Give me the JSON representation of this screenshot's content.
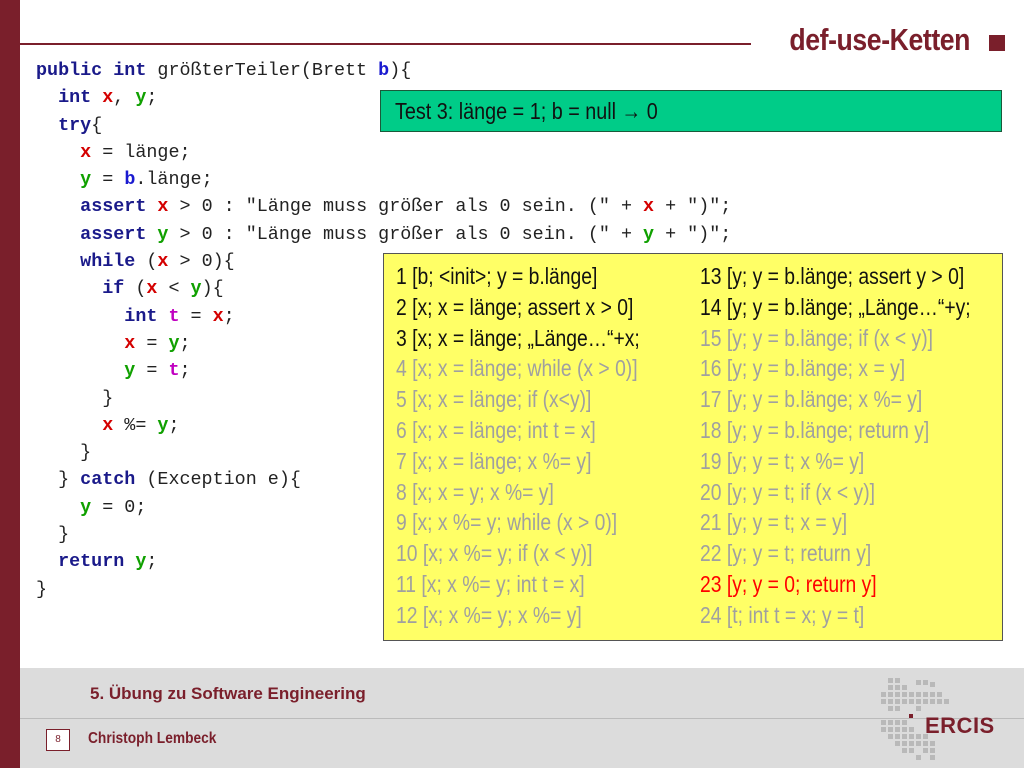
{
  "slide": {
    "title": "def-use-Ketten"
  },
  "code": [
    [
      {
        "t": "public",
        "c": "kw"
      },
      {
        "t": " "
      },
      {
        "t": "int",
        "c": "kw"
      },
      {
        "t": " größterTeiler(Brett "
      },
      {
        "t": "b",
        "c": "vb"
      },
      {
        "t": "){"
      }
    ],
    [
      {
        "t": "  "
      },
      {
        "t": "int",
        "c": "kw"
      },
      {
        "t": " "
      },
      {
        "t": "x",
        "c": "vx"
      },
      {
        "t": ", "
      },
      {
        "t": "y",
        "c": "vy"
      },
      {
        "t": ";"
      }
    ],
    [
      {
        "t": "  "
      },
      {
        "t": "try",
        "c": "kw"
      },
      {
        "t": "{"
      }
    ],
    [
      {
        "t": "    "
      },
      {
        "t": "x",
        "c": "vx"
      },
      {
        "t": " = länge;"
      }
    ],
    [
      {
        "t": "    "
      },
      {
        "t": "y",
        "c": "vy"
      },
      {
        "t": " = "
      },
      {
        "t": "b",
        "c": "vb"
      },
      {
        "t": ".länge;"
      }
    ],
    [
      {
        "t": "    "
      },
      {
        "t": "assert",
        "c": "kw"
      },
      {
        "t": " "
      },
      {
        "t": "x",
        "c": "vx"
      },
      {
        "t": " > 0 : \"Länge muss größer als 0 sein. (\" + "
      },
      {
        "t": "x",
        "c": "vx"
      },
      {
        "t": " + \")\";"
      }
    ],
    [
      {
        "t": "    "
      },
      {
        "t": "assert",
        "c": "kw"
      },
      {
        "t": " "
      },
      {
        "t": "y",
        "c": "vy"
      },
      {
        "t": " > 0 : \"Länge muss größer als 0 sein. (\" + "
      },
      {
        "t": "y",
        "c": "vy"
      },
      {
        "t": " + \")\";"
      }
    ],
    [
      {
        "t": "    "
      },
      {
        "t": "while",
        "c": "kw"
      },
      {
        "t": " ("
      },
      {
        "t": "x",
        "c": "vx"
      },
      {
        "t": " > 0){"
      }
    ],
    [
      {
        "t": "      "
      },
      {
        "t": "if",
        "c": "kw"
      },
      {
        "t": " ("
      },
      {
        "t": "x",
        "c": "vx"
      },
      {
        "t": " < "
      },
      {
        "t": "y",
        "c": "vy"
      },
      {
        "t": "){"
      }
    ],
    [
      {
        "t": "        "
      },
      {
        "t": "int",
        "c": "kw"
      },
      {
        "t": " "
      },
      {
        "t": "t",
        "c": "vt"
      },
      {
        "t": " = "
      },
      {
        "t": "x",
        "c": "vx"
      },
      {
        "t": ";"
      }
    ],
    [
      {
        "t": "        "
      },
      {
        "t": "x",
        "c": "vx"
      },
      {
        "t": " = "
      },
      {
        "t": "y",
        "c": "vy"
      },
      {
        "t": ";"
      }
    ],
    [
      {
        "t": "        "
      },
      {
        "t": "y",
        "c": "vy"
      },
      {
        "t": " = "
      },
      {
        "t": "t",
        "c": "vt"
      },
      {
        "t": ";"
      }
    ],
    [
      {
        "t": "      }"
      }
    ],
    [
      {
        "t": "      "
      },
      {
        "t": "x",
        "c": "vx"
      },
      {
        "t": " %= "
      },
      {
        "t": "y",
        "c": "vy"
      },
      {
        "t": ";"
      }
    ],
    [
      {
        "t": "    }"
      }
    ],
    [
      {
        "t": "  } "
      },
      {
        "t": "catch",
        "c": "kw"
      },
      {
        "t": " (Exception e){"
      }
    ],
    [
      {
        "t": "    "
      },
      {
        "t": "y",
        "c": "vy"
      },
      {
        "t": " = 0;"
      }
    ],
    [
      {
        "t": "  }"
      }
    ],
    [
      {
        "t": "  "
      },
      {
        "t": "return",
        "c": "kw"
      },
      {
        "t": " "
      },
      {
        "t": "y",
        "c": "vy"
      },
      {
        "t": ";"
      }
    ],
    [
      {
        "t": "}"
      }
    ]
  ],
  "test_case": {
    "prefix": "Test 3: länge = 1; b = null",
    "arrow": "→",
    "result": "0"
  },
  "chains_left": [
    {
      "text": "  1 [b; <init>; y = b.länge]",
      "status": "black"
    },
    {
      "text": "  2 [x; x = länge; assert x > 0]",
      "status": "black"
    },
    {
      "text": "  3 [x; x = länge; „Länge…“+x;",
      "status": "black"
    },
    {
      "text": "  4 [x; x = länge; while (x > 0)]",
      "status": "grey"
    },
    {
      "text": "  5 [x; x = länge; if (x<y)]",
      "status": "grey"
    },
    {
      "text": "  6 [x; x = länge; int t = x]",
      "status": "grey"
    },
    {
      "text": "  7 [x; x = länge; x %= y]",
      "status": "grey"
    },
    {
      "text": "  8 [x; x = y; x %= y]",
      "status": "grey"
    },
    {
      "text": "  9 [x; x %= y; while (x > 0)]",
      "status": "grey"
    },
    {
      "text": "10 [x; x %= y; if (x < y)]",
      "status": "grey"
    },
    {
      "text": "11 [x; x %= y; int t = x]",
      "status": "grey"
    },
    {
      "text": "12 [x; x %= y; x %= y]",
      "status": "grey"
    }
  ],
  "chains_right": [
    {
      "text": "13 [y; y = b.länge; assert y > 0]",
      "status": "black"
    },
    {
      "text": "14 [y; y = b.länge; „Länge…“+y;",
      "status": "black"
    },
    {
      "text": "15 [y; y = b.länge; if (x < y)]",
      "status": "grey"
    },
    {
      "text": "16 [y; y = b.länge; x = y]",
      "status": "grey"
    },
    {
      "text": "17 [y; y = b.länge; x %= y]",
      "status": "grey"
    },
    {
      "text": "18 [y; y = b.länge; return y]",
      "status": "grey"
    },
    {
      "text": "19 [y; y = t; x %= y]",
      "status": "grey"
    },
    {
      "text": "20 [y; y = t; if (x < y)]",
      "status": "grey"
    },
    {
      "text": "21 [y; y = t; x = y]",
      "status": "grey"
    },
    {
      "text": "22 [y; y = t; return y]",
      "status": "grey"
    },
    {
      "text": "23 [y; y = 0; return y]",
      "status": "red"
    },
    {
      "text": "24 [t; int t = x; y = t]",
      "status": "grey"
    }
  ],
  "footer": {
    "course": "5. Übung zu Software Engineering",
    "author": "Christoph Lembeck",
    "page": "8",
    "logo_text": "ERCIS"
  },
  "colors": {
    "brand": "#7a1f2b",
    "test_box_bg": "#00cc88",
    "chain_box_bg": "#ffff66",
    "chain_active": "#111111",
    "chain_inactive": "#a0a0a0",
    "chain_highlight": "#ff0000"
  }
}
